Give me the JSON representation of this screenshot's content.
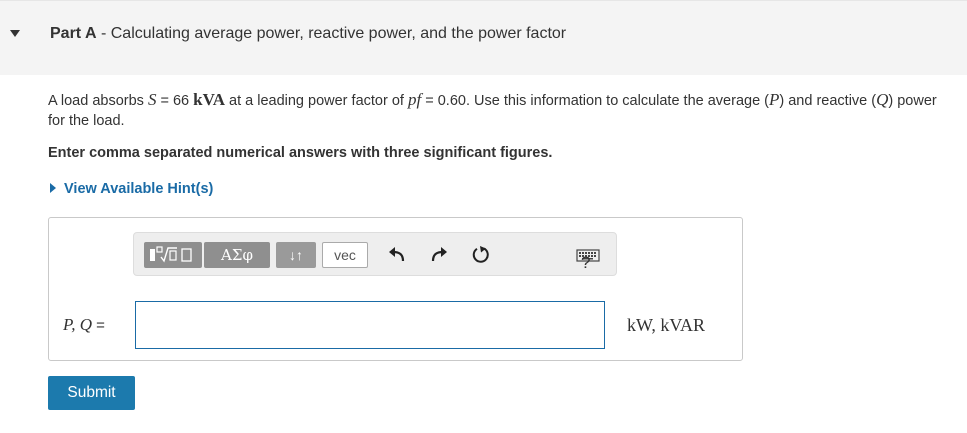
{
  "header": {
    "part_label": "Part A",
    "separator": " - ",
    "title": "Calculating average power, reactive power, and the power factor"
  },
  "problem": {
    "t1": "A load absorbs ",
    "S_sym": "S",
    "t2": " = 66 ",
    "S_unit": "kVA",
    "t3": " at a leading power factor of ",
    "pf_sym": "pf",
    "t4": " = 0.60. Use this information to calculate the average (",
    "P_sym": "P",
    "t5": ") and reactive (",
    "Q_sym": "Q",
    "t6": ") power for the load."
  },
  "instruction": "Enter comma separated numerical answers with three significant figures.",
  "hint_link": "View Available Hint(s)",
  "toolbar": {
    "greek_label": "ΑΣφ",
    "arrows_label": "↓↑",
    "vec_label": "vec",
    "help_label": "?",
    "icons": [
      "templates-icon",
      "undo-icon",
      "redo-icon",
      "reset-icon",
      "keyboard-icon"
    ]
  },
  "answer": {
    "label": "P, Q",
    "equals": " =",
    "value": "",
    "units": "kW, kVAR"
  },
  "submit_label": "Submit"
}
